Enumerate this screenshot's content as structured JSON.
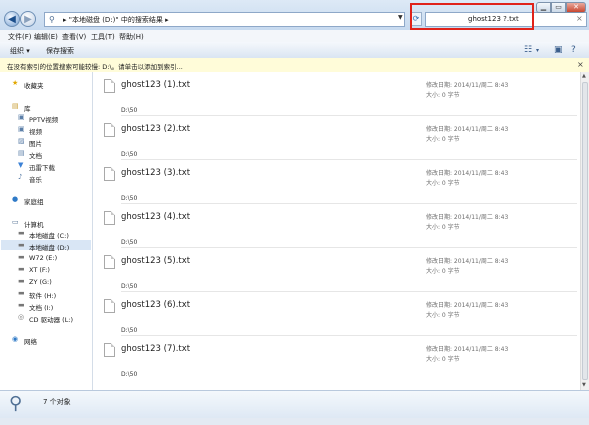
{
  "address": {
    "path_text": "\"本地磁盘 (D:)\" 中的搜索结果",
    "arrow": "▸"
  },
  "search": {
    "value": "ghost123 ?.txt"
  },
  "menu": [
    "文件(F)",
    "编辑(E)",
    "查看(V)",
    "工具(T)",
    "帮助(H)"
  ],
  "toolbar": {
    "organize": "组织 ▾",
    "save_search": "保存搜索"
  },
  "infobar": {
    "text": "在没有索引的位置搜索可能较慢: D:\\。请单击以添加到索引..."
  },
  "sidebar": {
    "favorites": "收藏夹",
    "library": "库",
    "library_items": [
      "PPTV视频",
      "视频",
      "图片",
      "文档",
      "迅雷下载",
      "音乐"
    ],
    "homegroup": "家庭组",
    "computer": "计算机",
    "drives": [
      "本地磁盘 (C:)",
      "本地磁盘 (D:)",
      "W72 (E:)",
      "XT (F:)",
      "ZY (G:)",
      "软件 (H:)",
      "文档 (I:)",
      "CD 驱动器 (L:)"
    ],
    "network": "网络"
  },
  "files": [
    {
      "name": "ghost123 (1).txt",
      "modified": "修改日期: 2014/11/周二 8:43",
      "size": "大小: 0 字节",
      "path": "D:\\50"
    },
    {
      "name": "ghost123 (2).txt",
      "modified": "修改日期: 2014/11/周二 8:43",
      "size": "大小: 0 字节",
      "path": "D:\\50"
    },
    {
      "name": "ghost123 (3).txt",
      "modified": "修改日期: 2014/11/周二 8:43",
      "size": "大小: 0 字节",
      "path": "D:\\50"
    },
    {
      "name": "ghost123 (4).txt",
      "modified": "修改日期: 2014/11/周二 8:43",
      "size": "大小: 0 字节",
      "path": "D:\\50"
    },
    {
      "name": "ghost123 (5).txt",
      "modified": "修改日期: 2014/11/周二 8:43",
      "size": "大小: 0 字节",
      "path": "D:\\50"
    },
    {
      "name": "ghost123 (6).txt",
      "modified": "修改日期: 2014/11/周二 8:43",
      "size": "大小: 0 字节",
      "path": "D:\\50"
    },
    {
      "name": "ghost123 (7).txt",
      "modified": "修改日期: 2014/11/周二 8:43",
      "size": "大小: 0 字节",
      "path": "D:\\50"
    }
  ],
  "status": {
    "count": "7 个对象"
  },
  "colors": {
    "highlight_border": "#e0221a",
    "selected_drive_bg": "#d9e6f5",
    "infobar_bg": "#fffcd9"
  }
}
